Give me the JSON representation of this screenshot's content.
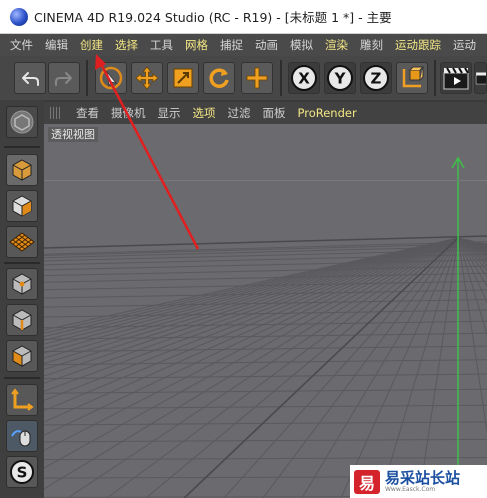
{
  "window": {
    "title": "CINEMA 4D R19.024 Studio (RC - R19) - [未标题 1 *] - 主要"
  },
  "menu": {
    "items": [
      {
        "label": "文件",
        "highlight": false
      },
      {
        "label": "编辑",
        "highlight": false
      },
      {
        "label": "创建",
        "highlight": true
      },
      {
        "label": "选择",
        "highlight": true
      },
      {
        "label": "工具",
        "highlight": false
      },
      {
        "label": "网格",
        "highlight": true
      },
      {
        "label": "捕捉",
        "highlight": false
      },
      {
        "label": "动画",
        "highlight": false
      },
      {
        "label": "模拟",
        "highlight": false
      },
      {
        "label": "渲染",
        "highlight": true
      },
      {
        "label": "雕刻",
        "highlight": false
      },
      {
        "label": "运动跟踪",
        "highlight": true
      },
      {
        "label": "运动",
        "highlight": false
      }
    ]
  },
  "toolbar": {
    "axis_x": "X",
    "axis_y": "Y",
    "axis_z": "Z"
  },
  "viewport_menu": {
    "items": [
      "查看",
      "摄像机",
      "显示",
      "选项",
      "过滤",
      "面板",
      "ProRender"
    ]
  },
  "viewport": {
    "label": "透视视图",
    "background_color": "#6b6a6e",
    "grid_color": "#5a595d",
    "axis_y_color": "#3fbf4a"
  },
  "annotation": {
    "arrow_color": "#e02020"
  },
  "watermark": {
    "logo_glyph": "易",
    "text": "易采站长站",
    "sub": "Www.Easck.Com"
  },
  "icons": {
    "undo": "undo-arrow-icon",
    "redo": "redo-arrow-icon",
    "select": "live-select-icon",
    "move": "move-icon",
    "scale": "scale-icon",
    "rotate": "rotate-icon",
    "add": "add-cross-icon",
    "coord": "coordinate-system-icon",
    "render": "render-clapper-icon"
  }
}
